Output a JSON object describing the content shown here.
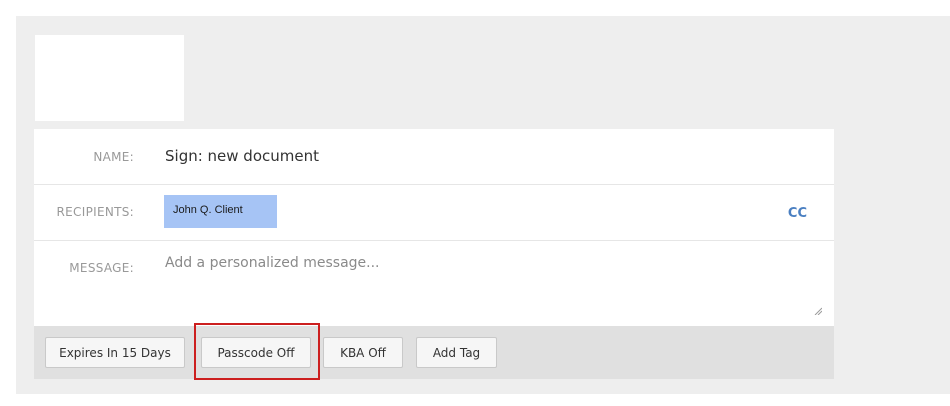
{
  "form": {
    "name_label": "NAME:",
    "name_value": "Sign: new document",
    "recipients_label": "RECIPIENTS:",
    "recipient_chip": "John Q. Client",
    "cc_label": "CC",
    "message_label": "MESSAGE:",
    "message_placeholder": "Add a personalized message...",
    "message_value": ""
  },
  "toolbar": {
    "expires_label": "Expires In 15 Days",
    "passcode_label": "Passcode Off",
    "kba_label": "KBA Off",
    "add_tag_label": "Add Tag"
  },
  "colors": {
    "chip_background": "#a6c4f5",
    "cc_link": "#4a7fc1",
    "highlight": "#cc1f1f",
    "page_background": "#eeeeee"
  }
}
